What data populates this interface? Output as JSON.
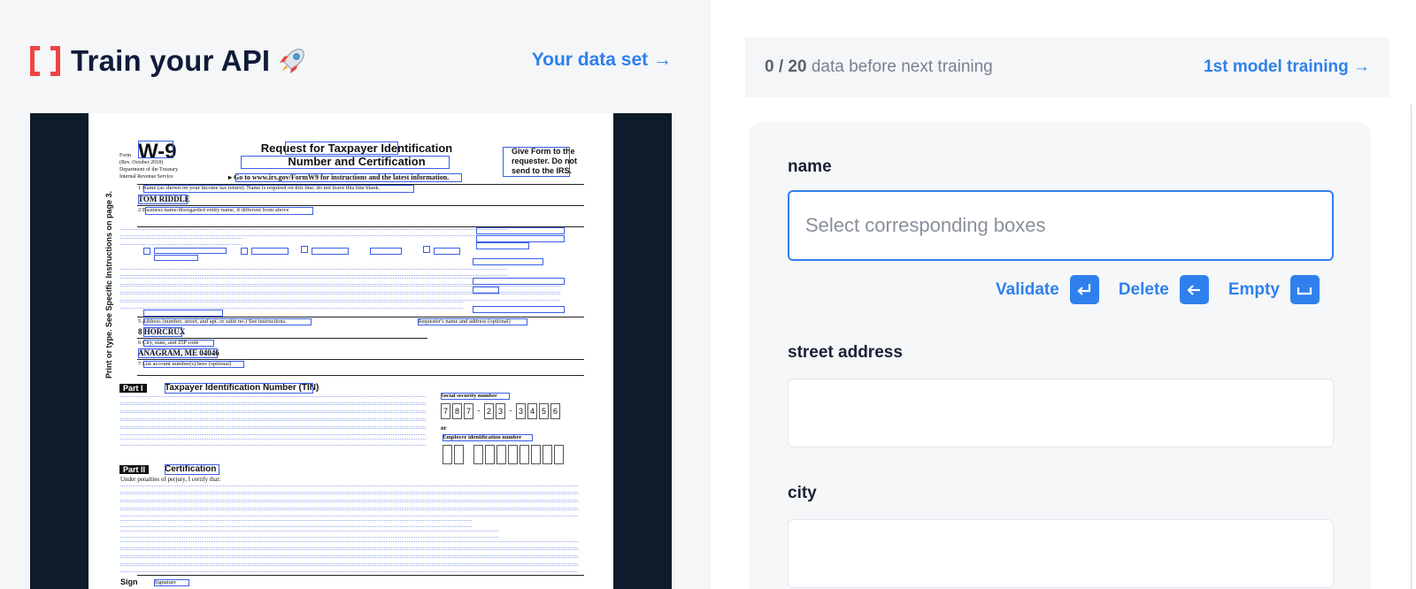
{
  "header": {
    "title": "Train your API",
    "dataset_link": "Your data set →"
  },
  "progress": {
    "count": "0 / 20",
    "suffix": "data before next training",
    "next_link": "1st model training →"
  },
  "form": {
    "fields": [
      {
        "label": "name",
        "value": "",
        "placeholder": "Select corresponding boxes"
      },
      {
        "label": "street address",
        "value": "",
        "placeholder": ""
      },
      {
        "label": "city",
        "value": "",
        "placeholder": ""
      }
    ],
    "actions": {
      "validate": "Validate",
      "delete": "Delete",
      "empty": "Empty"
    }
  },
  "document": {
    "form_id": "W-9",
    "form_meta": "Form\n(Rev. October 2018)\nDepartment of the Treasury\nInternal Revenue Service",
    "heading": "Request for Taxpayer Identification Number and Certification",
    "give_form": "Give Form to the requester. Do not send to the IRS.",
    "goto": "▸ Go to www.irs.gov/FormW9 for instructions and the latest information.",
    "line1_label": "1 Name (as shown on your income tax return). Name is required on this line; do not leave this line blank.",
    "name_value": "TOM RIDDLE",
    "line2_label": "2 Business name/disregarded entity name, if different from above",
    "line5_label": "5 Address (number, street, and apt. or suite no.) See instructions.",
    "address_value": "8 HORCRUX",
    "line6_label": "6 City, state, and ZIP code",
    "city_value": "ANAGRAM, ME 04046",
    "line7_label": "7 List account number(s) here (optional)",
    "requester": "Requester's name and address (optional)",
    "side_text": "Print or type. See Specific Instructions on page 3.",
    "part1": "Part I",
    "part1_title": "Taxpayer Identification Number (TIN)",
    "ssn_label": "Social security number",
    "ssn_digits": [
      "7",
      "8",
      "7",
      "-",
      "2",
      "3",
      "-",
      "3",
      "4",
      "5",
      "6"
    ],
    "or_label": "or",
    "ein_label": "Employer identification number",
    "part2": "Part II",
    "part2_title": "Certification",
    "under_penalties": "Under penalties of perjury, I certify that:",
    "sign": "Sign",
    "signature": "Signature"
  }
}
